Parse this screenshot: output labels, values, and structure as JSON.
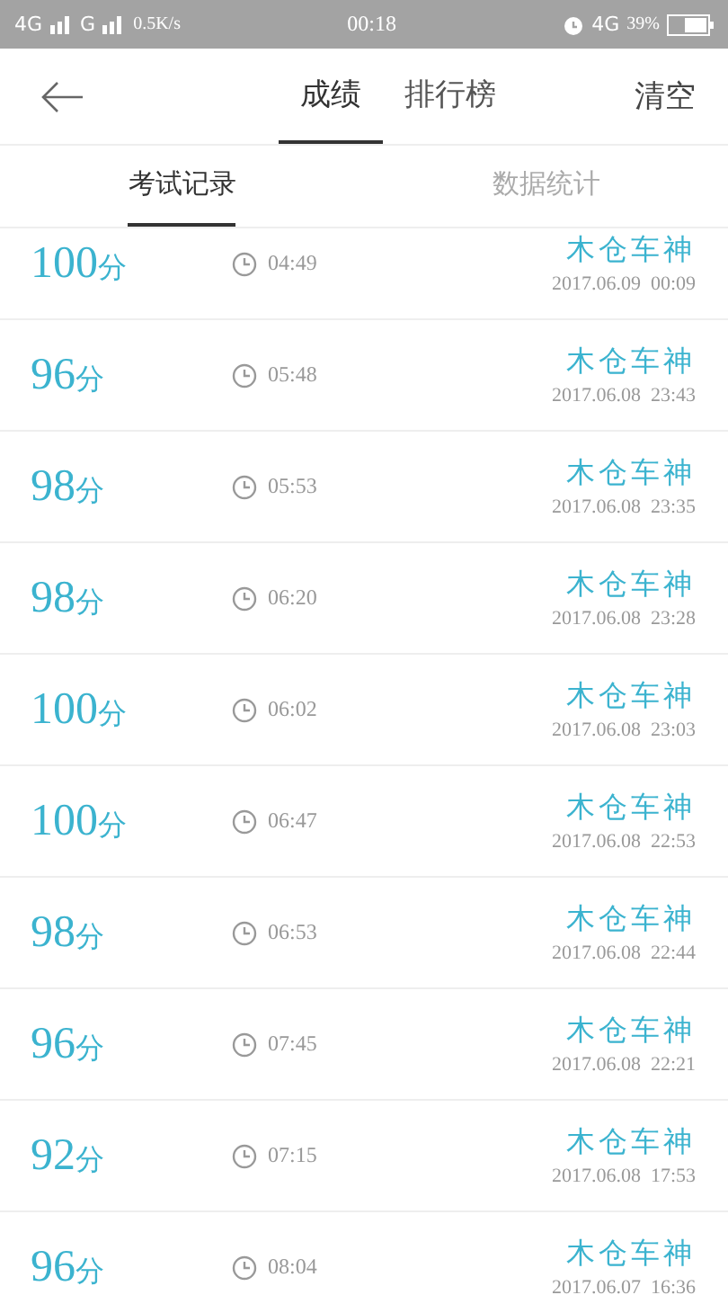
{
  "status_bar": {
    "left": [
      "4G",
      "G"
    ],
    "speed": "0.5K/s",
    "time": "00:18",
    "network": "4G",
    "battery": "39%"
  },
  "header": {
    "tabs": [
      {
        "label": "成绩",
        "selected": true
      },
      {
        "label": "排行榜",
        "selected": false
      }
    ],
    "action": "清空"
  },
  "sub_tabs": [
    {
      "label": "考试记录",
      "selected": true
    },
    {
      "label": "数据统计",
      "selected": false
    }
  ],
  "records": [
    {
      "score": "100",
      "unit": "分",
      "duration": "04:49",
      "name": "木仓车神",
      "date": "2017.06.09  00:09"
    },
    {
      "score": "96",
      "unit": "分",
      "duration": "05:48",
      "name": "木仓车神",
      "date": "2017.06.08  23:43"
    },
    {
      "score": "98",
      "unit": "分",
      "duration": "05:53",
      "name": "木仓车神",
      "date": "2017.06.08  23:35"
    },
    {
      "score": "98",
      "unit": "分",
      "duration": "06:20",
      "name": "木仓车神",
      "date": "2017.06.08  23:28"
    },
    {
      "score": "100",
      "unit": "分",
      "duration": "06:02",
      "name": "木仓车神",
      "date": "2017.06.08  23:03"
    },
    {
      "score": "100",
      "unit": "分",
      "duration": "06:47",
      "name": "木仓车神",
      "date": "2017.06.08  22:53"
    },
    {
      "score": "98",
      "unit": "分",
      "duration": "06:53",
      "name": "木仓车神",
      "date": "2017.06.08  22:44"
    },
    {
      "score": "96",
      "unit": "分",
      "duration": "07:45",
      "name": "木仓车神",
      "date": "2017.06.08  22:21"
    },
    {
      "score": "92",
      "unit": "分",
      "duration": "07:15",
      "name": "木仓车神",
      "date": "2017.06.08  17:53"
    },
    {
      "score": "96",
      "unit": "分",
      "duration": "08:04",
      "name": "木仓车神",
      "date": "2017.06.07  16:36"
    }
  ]
}
